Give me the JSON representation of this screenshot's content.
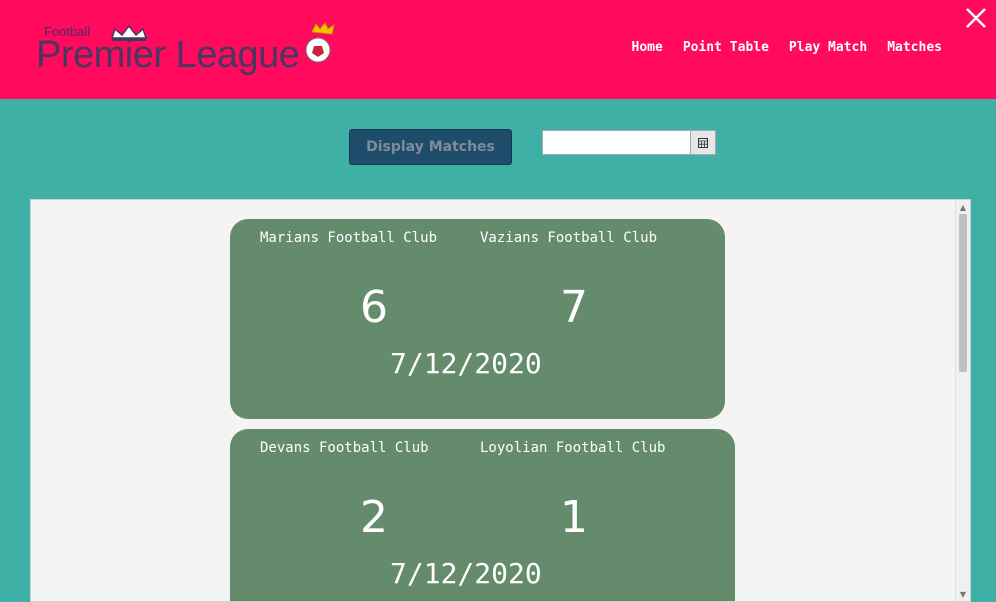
{
  "logo": {
    "small_text": "Football",
    "main_text": "Premier League"
  },
  "nav": {
    "items": [
      {
        "label": "Home"
      },
      {
        "label": "Point Table"
      },
      {
        "label": "Play Match"
      },
      {
        "label": "Matches"
      }
    ]
  },
  "toolbar": {
    "display_label": "Display Matches"
  },
  "date_picker": {
    "value": ""
  },
  "matches": [
    {
      "home": "Marians Football Club",
      "away": "Vazians Football Club",
      "home_score": "6",
      "away_score": "7",
      "date": "7/12/2020"
    },
    {
      "home": "Devans Football Club",
      "away": "Loyolian Football Club",
      "home_score": "2",
      "away_score": "1",
      "date": "7/12/2020"
    }
  ],
  "colors": {
    "header": "#ff0a5c",
    "background": "#3eb0a6",
    "card": "#658b6d",
    "button": "#1e4d6c"
  },
  "icons": {
    "close": "close-icon",
    "calendar": "calendar-icon",
    "crown": "crown-icon",
    "ball": "football-icon"
  }
}
